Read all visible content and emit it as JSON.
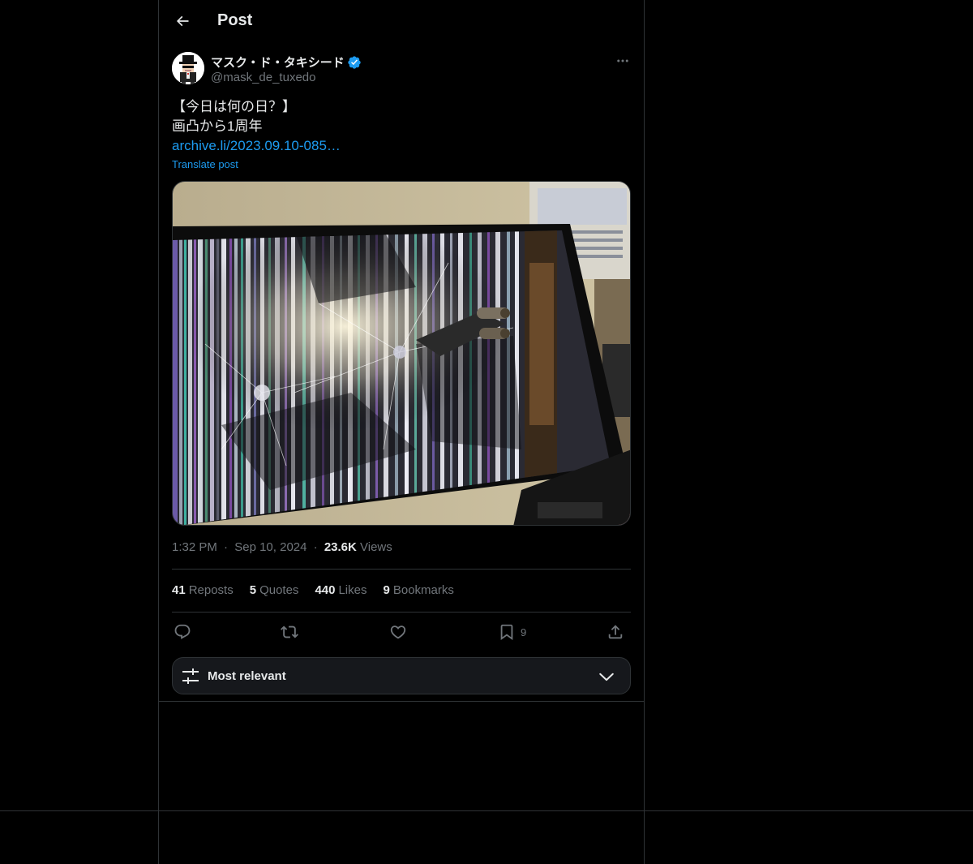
{
  "header": {
    "title": "Post",
    "back_icon": "arrow-left-icon"
  },
  "author": {
    "name": "マスク・ド・タキシード",
    "handle": "@mask_de_tuxedo",
    "verified": true,
    "avatar_icon": "avatar-icon"
  },
  "post": {
    "lines": [
      "【今日は何の日？】",
      "画凸から1周年"
    ],
    "link_text": "archive.li/2023.09.10-085…",
    "translate_label": "Translate post",
    "image_alt": "Shattered monitor screen with colored vertical lines and a cracked impact point"
  },
  "meta": {
    "time": "1:32 PM",
    "separator": "·",
    "date": "Sep 10, 2024",
    "views_count": "23.6K",
    "views_label": "Views"
  },
  "stats": [
    {
      "count": "41",
      "label": "Reposts"
    },
    {
      "count": "5",
      "label": "Quotes"
    },
    {
      "count": "440",
      "label": "Likes"
    },
    {
      "count": "9",
      "label": "Bookmarks"
    }
  ],
  "actions": {
    "reply_icon": "reply-icon",
    "repost_icon": "repost-icon",
    "like_icon": "heart-icon",
    "bookmark_icon": "bookmark-icon",
    "bookmark_count": "9",
    "share_icon": "share-icon"
  },
  "sort": {
    "label": "Most relevant",
    "icon": "sliders-icon",
    "chevron": "chevron-down-icon"
  },
  "colors": {
    "accent": "#1d9bf0",
    "text": "#e7e9ea",
    "muted": "#71767b",
    "border": "#2f3336",
    "background": "#000000"
  }
}
